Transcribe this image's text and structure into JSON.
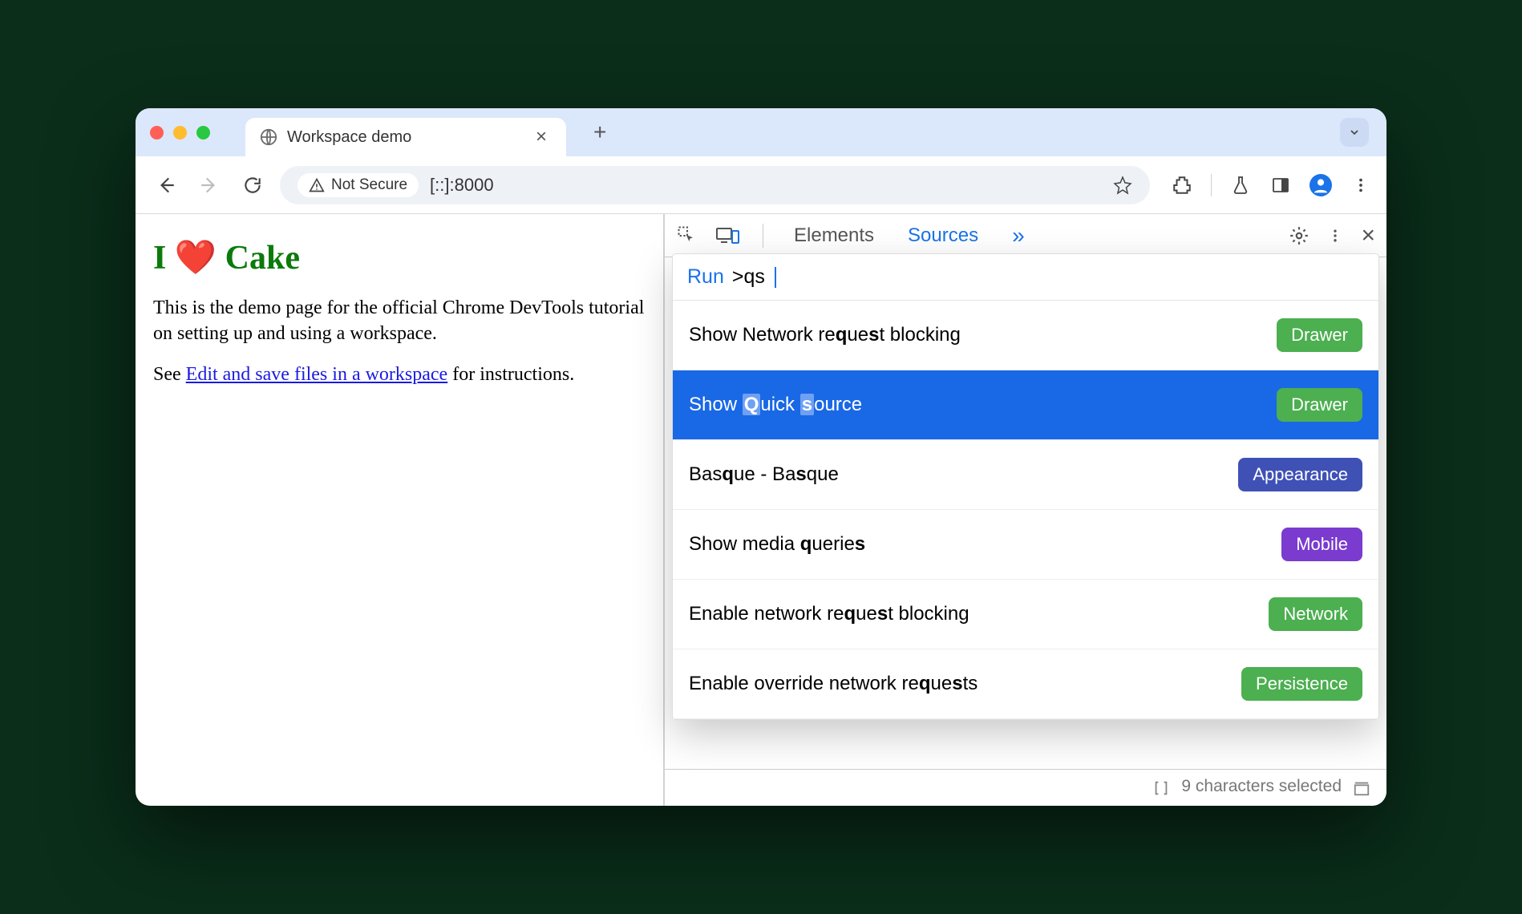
{
  "tab": {
    "title": "Workspace demo"
  },
  "toolbar": {
    "security": "Not Secure",
    "url": "[::]:8000"
  },
  "page": {
    "h1": "I ❤️ Cake",
    "p1": "This is the demo page for the official Chrome DevTools tutorial on setting up and using a workspace.",
    "p2a": "See ",
    "link": "Edit and save files in a workspace",
    "p2b": " for instructions."
  },
  "devtools": {
    "tabs": {
      "elements": "Elements",
      "sources": "Sources"
    },
    "command": {
      "run": "Run",
      "query": ">qs"
    },
    "items": [
      {
        "pre": "Show Network re",
        "b1": "q",
        "mid1": "ue",
        "b2": "s",
        "mid2": "t blocking",
        "badge": "Drawer",
        "badgeColor": "green",
        "sel": false
      },
      {
        "pre": "Show ",
        "b1": "Q",
        "mid1": "uick ",
        "b2": "s",
        "mid2": "ource",
        "badge": "Drawer",
        "badgeColor": "green",
        "sel": true
      },
      {
        "pre": "Bas",
        "b1": "q",
        "mid1": "ue - Ba",
        "b2": "s",
        "mid2": "que",
        "badge": "Appearance",
        "badgeColor": "blue",
        "sel": false
      },
      {
        "pre": "Show media ",
        "b1": "q",
        "mid1": "uerie",
        "b2": "s",
        "mid2": "",
        "badge": "Mobile",
        "badgeColor": "purple",
        "sel": false
      },
      {
        "pre": "Enable network re",
        "b1": "q",
        "mid1": "ue",
        "b2": "s",
        "mid2": "t blocking",
        "badge": "Network",
        "badgeColor": "green",
        "sel": false
      },
      {
        "pre": "Enable override network re",
        "b1": "q",
        "mid1": "ue",
        "b2": "s",
        "mid2": "ts",
        "badge": "Persistence",
        "badgeColor": "green",
        "sel": false
      }
    ],
    "footer": "9 characters selected"
  }
}
